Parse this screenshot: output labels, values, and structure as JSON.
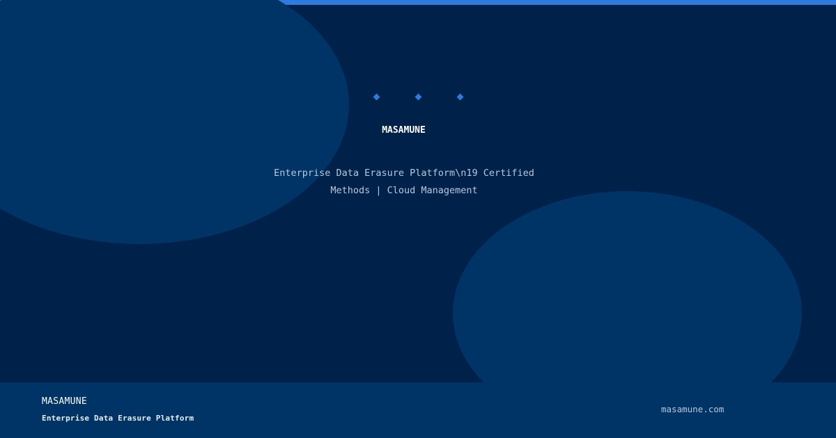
{
  "colors": {
    "accent": "#2f7ae0",
    "background": "#00224a",
    "panel": "#003366",
    "text_primary": "#ffffff",
    "text_secondary": "#b8c8da"
  },
  "hero": {
    "indicator_dots": [
      "dot",
      "dot",
      "dot"
    ],
    "title": "MASAMUNE",
    "subtitle": "Enterprise Data Erasure Platform\\n19 Certified Methods | Cloud Management"
  },
  "footer": {
    "brand": "MASAMUNE",
    "tagline": "Enterprise Data Erasure Platform",
    "url": "masamune.com"
  }
}
